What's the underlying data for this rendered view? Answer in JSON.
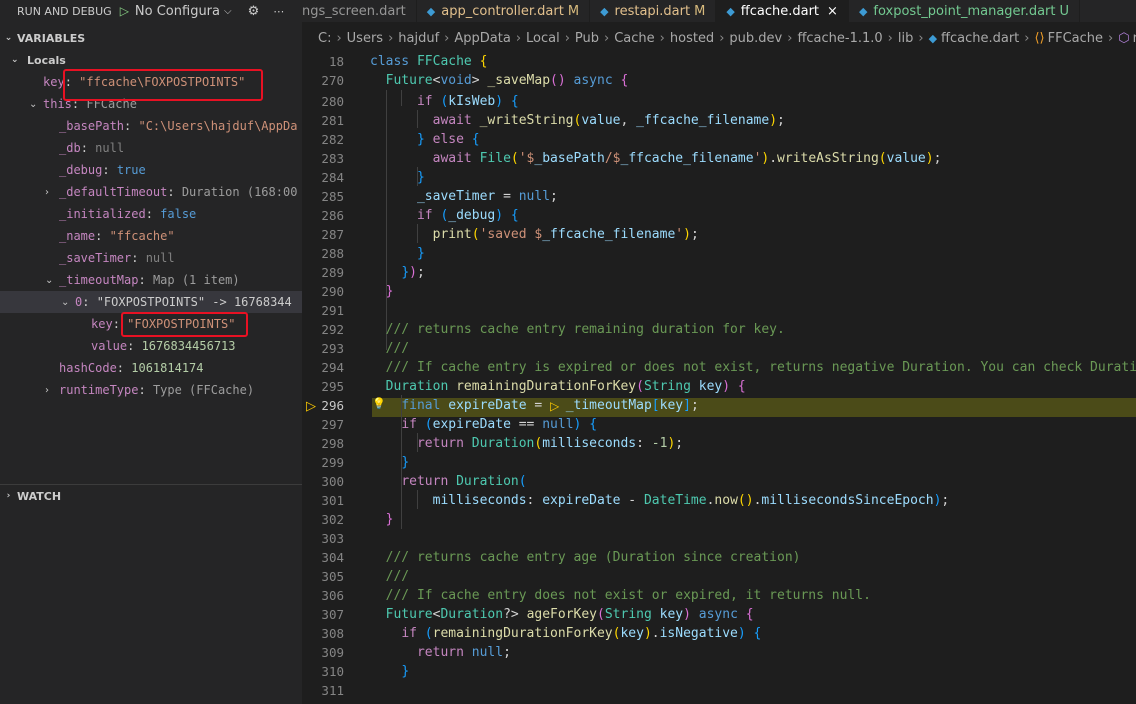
{
  "debug": {
    "title": "RUN AND DEBUG",
    "config_label": "No Configura",
    "variables_header": "VARIABLES",
    "locals_label": "Locals",
    "watch_header": "WATCH"
  },
  "variables": {
    "key": {
      "name": "key",
      "value": "\"ffcache\\FOXPOSTPOINTS\""
    },
    "this": {
      "name": "this",
      "value": "FFCache"
    },
    "basePath": {
      "name": "_basePath",
      "value": "\"C:\\Users\\hajduf\\AppDa"
    },
    "db": {
      "name": "_db",
      "value": "null"
    },
    "debug": {
      "name": "_debug",
      "value": "true"
    },
    "defaultTimeout": {
      "name": "_defaultTimeout",
      "value": "Duration (168:00"
    },
    "initialized": {
      "name": "_initialized",
      "value": "false"
    },
    "name": {
      "name": "_name",
      "value": "\"ffcache\""
    },
    "saveTimer": {
      "name": "_saveTimer",
      "value": "null"
    },
    "timeoutMap": {
      "name": "_timeoutMap",
      "value": "Map (1 item)"
    },
    "entry0": {
      "name": "0",
      "value": "\"FOXPOSTPOINTS\" -> 16768344"
    },
    "entryKey": {
      "name": "key",
      "value": "\"FOXPOSTPOINTS\""
    },
    "entryValue": {
      "name": "value",
      "value": "1676834456713"
    },
    "hashCode": {
      "name": "hashCode",
      "value": "1061814174"
    },
    "runtimeType": {
      "name": "runtimeType",
      "value": "Type (FFCache)"
    }
  },
  "tabs": [
    {
      "label": "ngs_screen.dart",
      "status": ""
    },
    {
      "label": "app_controller.dart",
      "status": "M"
    },
    {
      "label": "restapi.dart",
      "status": "M"
    },
    {
      "label": "ffcache.dart",
      "status": "×"
    },
    {
      "label": "foxpost_point_manager.dart",
      "status": "U"
    }
  ],
  "breadcrumb": [
    "C:",
    "Users",
    "hajduf",
    "AppData",
    "Local",
    "Pub",
    "Cache",
    "hosted",
    "pub.dev",
    "ffcache-1.1.0",
    "lib",
    "ffcache.dart",
    "FFCache",
    "remainin"
  ],
  "gutter": [
    "18",
    "270",
    "280",
    "281",
    "282",
    "283",
    "284",
    "285",
    "286",
    "287",
    "288",
    "289",
    "290",
    "291",
    "292",
    "293",
    "294",
    "295",
    "296",
    "297",
    "298",
    "299",
    "300",
    "301",
    "302",
    "303",
    "304",
    "305",
    "306",
    "307",
    "308",
    "309",
    "310",
    "311"
  ],
  "icons": {
    "play": "play-icon",
    "gear": "gear-icon",
    "more": "more-icon",
    "breakpoint": "breakpoint-arrow-icon",
    "lightbulb": "lightbulb-icon"
  }
}
